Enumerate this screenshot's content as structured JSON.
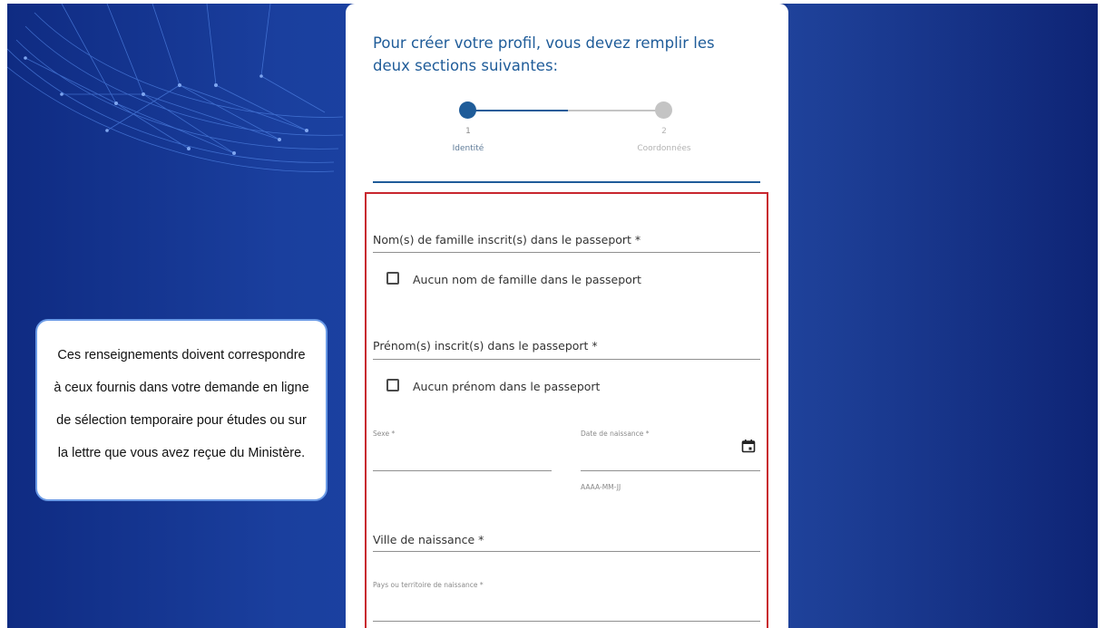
{
  "intro": {
    "line1": "Pour créer votre profil, vous devez remplir les",
    "line2": "deux sections suivantes:"
  },
  "stepper": {
    "steps": [
      {
        "number": "1",
        "label": "Identité",
        "active": true
      },
      {
        "number": "2",
        "label": "Coordonnées",
        "active": false
      }
    ]
  },
  "form": {
    "surname_label": "Nom(s) de famille inscrit(s) dans le passeport *",
    "no_surname_label": "Aucun nom de famille dans le passeport",
    "no_surname_checked": false,
    "given_name_label": "Prénom(s) inscrit(s) dans le passeport *",
    "no_given_name_label": "Aucun prénom dans le passeport",
    "no_given_name_checked": false,
    "sex_label": "Sexe *",
    "birthdate_label": "Date de naissance *",
    "birthdate_hint": "AAAA-MM-JJ",
    "birth_city_label": "Ville de naissance *",
    "birth_country_label": "Pays ou territoire de naissance *"
  },
  "info_box": {
    "lines": [
      "Ces renseignements doivent correspondre",
      "à ceux fournis dans votre demande en ligne",
      "de sélection temporaire pour études ou sur",
      "la lettre que vous avez reçue du Ministère."
    ]
  },
  "colors": {
    "primary": "#1f5c99",
    "highlight_border": "#c8262e",
    "background": "#1a3f9e",
    "inactive": "#c4c4c4"
  }
}
